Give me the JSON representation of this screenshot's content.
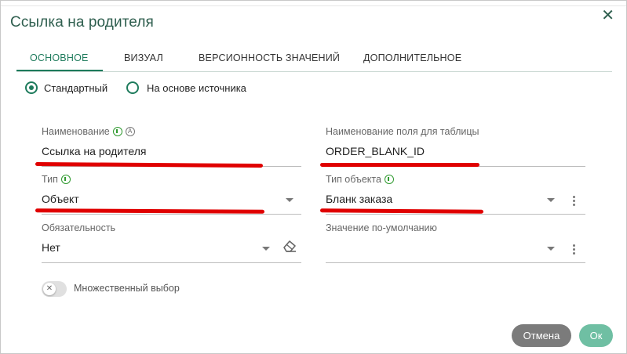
{
  "dialog": {
    "title": "Ссылка на родителя",
    "close_glyph": "✕"
  },
  "tabs": [
    {
      "label": "ОСНОВНОЕ",
      "active": true
    },
    {
      "label": "ВИЗУАЛ",
      "active": false
    },
    {
      "label": "ВЕРСИОННОСТЬ ЗНАЧЕНИЙ",
      "active": false
    },
    {
      "label": "ДОПОЛНИТЕЛЬНОЕ",
      "active": false
    }
  ],
  "source_mode": {
    "options": [
      {
        "label": "Стандартный",
        "checked": true
      },
      {
        "label": "На основе источника",
        "checked": false
      }
    ]
  },
  "fields": {
    "name": {
      "label": "Наименование",
      "value": "Ссылка на родителя",
      "auto_badge": "A"
    },
    "table_field_name": {
      "label": "Наименование поля для таблицы",
      "value": "ORDER_BLANK_ID"
    },
    "type": {
      "label": "Тип",
      "value": "Объект"
    },
    "object_type": {
      "label": "Тип объекта",
      "value": "Бланк заказа"
    },
    "required": {
      "label": "Обязательность",
      "value": "Нет"
    },
    "default_value": {
      "label": "Значение по-умолчанию",
      "value": ""
    }
  },
  "multi_select": {
    "label": "Множественный выбор",
    "enabled": false,
    "knob_glyph": "✕"
  },
  "buttons": {
    "cancel": "Отмена",
    "ok": "Ок"
  },
  "colors": {
    "accent": "#1e7b5c",
    "title": "#2e5e4e",
    "info_icon": "#2f9a2f",
    "annotation_red": "#e00000",
    "cancel_bg": "#7b7b7b",
    "ok_bg": "#6fbfa3"
  },
  "icons": [
    "close-icon",
    "info-icon",
    "auto-icon",
    "chevron-down-icon",
    "more-vert-icon",
    "eraser-icon"
  ]
}
